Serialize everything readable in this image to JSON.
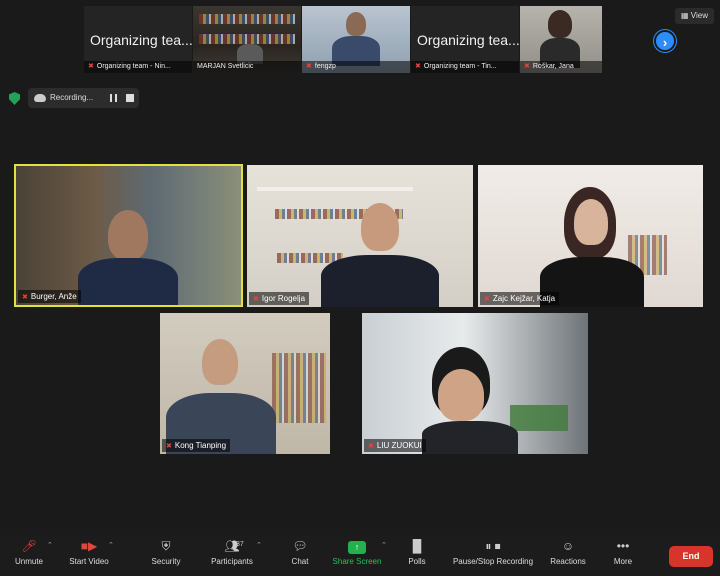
{
  "thumbnails": [
    {
      "big_text": "Organizing tea...",
      "caption": "Organizing team - Nin..."
    },
    {
      "caption": "MARJAN Svetlicic"
    },
    {
      "caption": "fengzp"
    },
    {
      "big_text": "Organizing tea...",
      "caption": "Organizing team - Tin..."
    },
    {
      "caption": "Roškar, Jana"
    }
  ],
  "view_label": "View",
  "recording": {
    "label": "Recording..."
  },
  "tiles": [
    {
      "name": "Burger, Anže"
    },
    {
      "name": "Igor Rogelja"
    },
    {
      "name": "Zajc Kejžar, Katja"
    },
    {
      "name": "Kong Tianping"
    },
    {
      "name": "LIU ZUOKUI"
    }
  ],
  "toolbar": {
    "unmute": "Unmute",
    "start_video": "Start Video",
    "security": "Security",
    "participants": "Participants",
    "participants_count": "37",
    "chat": "Chat",
    "share_screen": "Share Screen",
    "polls": "Polls",
    "pause_stop_recording": "Pause/Stop Recording",
    "reactions": "Reactions",
    "more": "More",
    "end": "End"
  },
  "colors": {
    "active_speaker_border": "#e3e23b",
    "share_green": "#22b14c",
    "end_red": "#d8352a",
    "nav_blue": "#2d8cff"
  }
}
